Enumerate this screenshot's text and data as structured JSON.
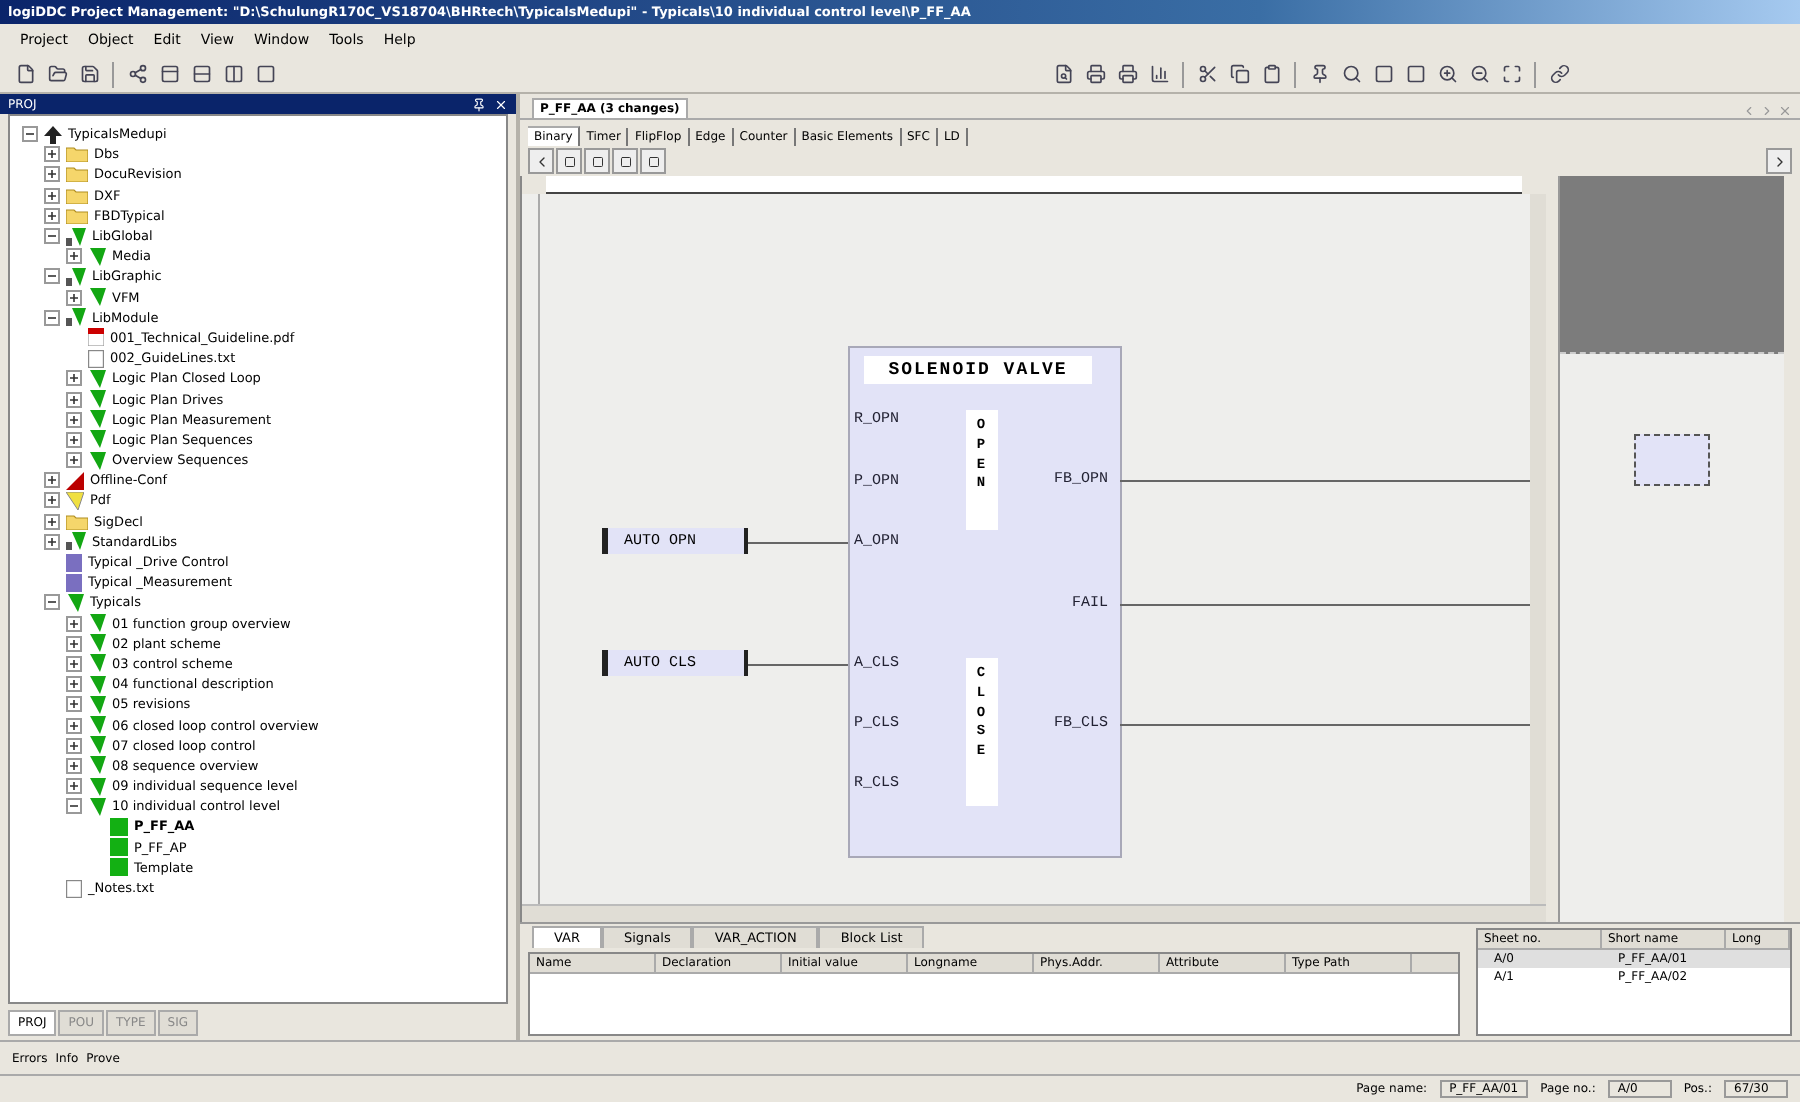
{
  "window": {
    "title": "logiDDC Project Management: \"D:\\SchulungR170C_VS18704\\BHRtech\\TypicalsMedupi\" - Typicals\\10 individual control level\\P_FF_AA"
  },
  "menu": [
    "Project",
    "Object",
    "Edit",
    "View",
    "Window",
    "Tools",
    "Help"
  ],
  "project_panel": {
    "title": "PROJ",
    "tree": [
      {
        "label": "TypicalsMedupi",
        "kind": "root",
        "expanded": true,
        "children": [
          {
            "label": "Dbs",
            "kind": "folder",
            "expanded": false
          },
          {
            "label": "DocuRevision",
            "kind": "folder",
            "expanded": false
          },
          {
            "label": "DXF",
            "kind": "folder",
            "expanded": false
          },
          {
            "label": "FBDTypical",
            "kind": "folder",
            "expanded": false
          },
          {
            "label": "LibGlobal",
            "kind": "lib",
            "expanded": true,
            "children": [
              {
                "label": "Media",
                "kind": "module",
                "expanded": false
              }
            ]
          },
          {
            "label": "LibGraphic",
            "kind": "lib",
            "expanded": true,
            "children": [
              {
                "label": "VFM",
                "kind": "module",
                "expanded": false
              }
            ]
          },
          {
            "label": "LibModule",
            "kind": "lib",
            "expanded": true,
            "children": [
              {
                "label": "001_Technical_Guideline.pdf",
                "kind": "pdf"
              },
              {
                "label": "002_GuideLines.txt",
                "kind": "txt"
              },
              {
                "label": "Logic Plan Closed Loop",
                "kind": "module",
                "expanded": false
              },
              {
                "label": "Logic Plan Drives",
                "kind": "module",
                "expanded": false
              },
              {
                "label": "Logic Plan Measurement",
                "kind": "module",
                "expanded": false
              },
              {
                "label": "Logic Plan Sequences",
                "kind": "module",
                "expanded": false
              },
              {
                "label": "Overview Sequences",
                "kind": "module",
                "expanded": false
              }
            ]
          },
          {
            "label": "Offline-Conf",
            "kind": "offline",
            "expanded": false
          },
          {
            "label": "Pdf",
            "kind": "pdffolder",
            "expanded": false
          },
          {
            "label": "SigDecl",
            "kind": "folder",
            "expanded": false
          },
          {
            "label": "StandardLibs",
            "kind": "lib",
            "expanded": false
          },
          {
            "label": "Typical _Drive Control",
            "kind": "doc"
          },
          {
            "label": "Typical _Measurement",
            "kind": "doc"
          },
          {
            "label": "Typicals",
            "kind": "module",
            "expanded": true,
            "children": [
              {
                "label": "01 function group overview",
                "kind": "module",
                "expanded": false
              },
              {
                "label": "02 plant scheme",
                "kind": "module",
                "expanded": false
              },
              {
                "label": "03 control scheme",
                "kind": "module",
                "expanded": false
              },
              {
                "label": "04 functional description",
                "kind": "module",
                "expanded": false
              },
              {
                "label": "05 revisions",
                "kind": "module",
                "expanded": false
              },
              {
                "label": "06 closed loop control overview",
                "kind": "module",
                "expanded": false
              },
              {
                "label": "07 closed loop control",
                "kind": "module",
                "expanded": false
              },
              {
                "label": "08 sequence overview",
                "kind": "module",
                "expanded": false
              },
              {
                "label": "09 individual sequence level",
                "kind": "module",
                "expanded": false
              },
              {
                "label": "10 individual control level",
                "kind": "module",
                "expanded": true,
                "children": [
                  {
                    "label": "P_FF_AA",
                    "kind": "block",
                    "selected": true
                  },
                  {
                    "label": "P_FF_AP",
                    "kind": "block",
                    "selected": false
                  },
                  {
                    "label": "Template",
                    "kind": "block",
                    "selected": false
                  }
                ]
              }
            ]
          },
          {
            "label": "_Notes.txt",
            "kind": "txt"
          }
        ]
      }
    ],
    "tabs": [
      {
        "label": "PROJ",
        "selected": true
      },
      {
        "label": "POU",
        "selected": false
      },
      {
        "label": "TYPE",
        "selected": false
      },
      {
        "label": "SIG",
        "selected": false
      }
    ]
  },
  "document_tab": "P_FF_AA (3 changes)",
  "palette_tabs": [
    {
      "label": "Binary",
      "selected": true
    },
    {
      "label": "Timer",
      "selected": false
    },
    {
      "label": "FlipFlop",
      "selected": false
    },
    {
      "label": "Edge",
      "selected": false
    },
    {
      "label": "Counter",
      "selected": false
    },
    {
      "label": "Basic Elements",
      "selected": false
    },
    {
      "label": "SFC",
      "selected": false
    },
    {
      "label": "LD",
      "selected": false
    }
  ],
  "block": {
    "title": "SOLENOID VALVE",
    "sections": [
      "OPEN",
      "CLOSE"
    ],
    "inputs": [
      {
        "name": "R_OPN"
      },
      {
        "name": "P_OPN"
      },
      {
        "name": "A_OPN",
        "connector": "AUTO OPN"
      },
      {
        "name": "A_CLS",
        "connector": "AUTO CLS"
      },
      {
        "name": "P_CLS"
      },
      {
        "name": "R_CLS"
      }
    ],
    "outputs": [
      "FB_OPN",
      "FAIL",
      "FB_CLS"
    ]
  },
  "var_tabs": [
    {
      "label": "VAR",
      "selected": true
    },
    {
      "label": "Signals",
      "selected": false
    },
    {
      "label": "VAR_ACTION",
      "selected": false
    },
    {
      "label": "Block List",
      "selected": false
    }
  ],
  "var_columns": [
    "Name",
    "Declaration",
    "Initial value",
    "Longname",
    "Phys.Addr.",
    "Attribute",
    "Type Path"
  ],
  "sheets": {
    "columns": [
      "Sheet no.",
      "Short name",
      "Long"
    ],
    "rows": [
      {
        "sheet": "A/0",
        "short_name": "P_FF_AA/01",
        "selected": true
      },
      {
        "sheet": "A/1",
        "short_name": "P_FF_AA/02",
        "selected": false
      }
    ]
  },
  "output_tabs": [
    "Errors",
    "Info",
    "Prove"
  ],
  "status_bar": [
    {
      "label": "Page name:",
      "value": "P_FF_AA/01"
    },
    {
      "label": "Page no.:",
      "value": "A/0"
    },
    {
      "label": "Pos.:",
      "value": "67/30"
    }
  ]
}
